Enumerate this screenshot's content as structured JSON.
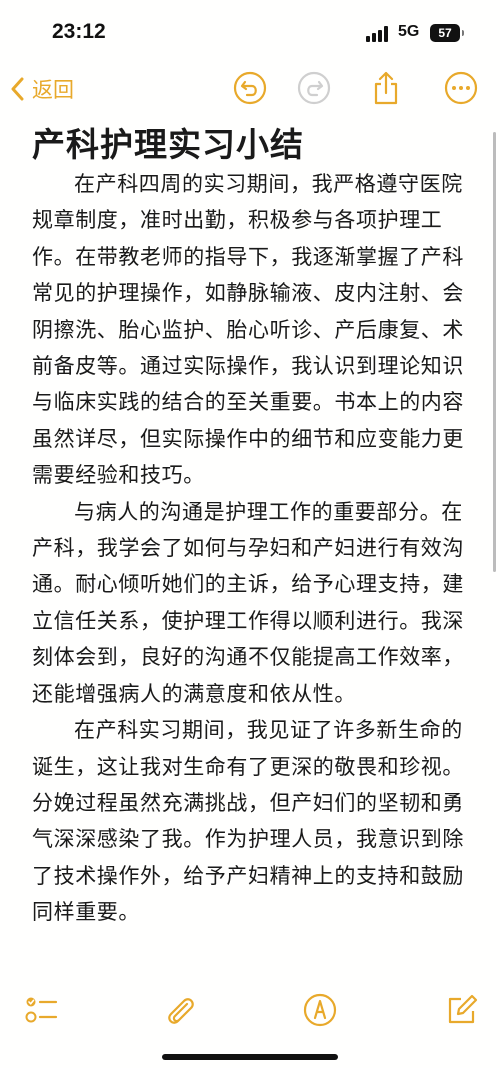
{
  "status_bar": {
    "time": "23:12",
    "network": "5G",
    "battery": "57"
  },
  "nav": {
    "back_label": "返回",
    "accent_color": "#e8a92b"
  },
  "note": {
    "title": "产科护理实习小结",
    "paragraphs": [
      "在产科四周的实习期间，我严格遵守医院规章制度，准时出勤，积极参与各项护理工作。在带教老师的指导下，我逐渐掌握了产科常见的护理操作，如静脉输液、皮内注射、会阴擦洗、胎心监护、胎心听诊、产后康复、术前备皮等。通过实际操作，我认识到理论知识与临床实践的结合的至关重要。书本上的内容虽然详尽，但实际操作中的细节和应变能力更需要经验和技巧。",
      "与病人的沟通是护理工作的重要部分。在产科，我学会了如何与孕妇和产妇进行有效沟通。耐心倾听她们的主诉，给予心理支持，建立信任关系，使护理工作得以顺利进行。我深刻体会到，良好的沟通不仅能提高工作效率，还能增强病人的满意度和依从性。",
      "在产科实习期间，我见证了许多新生命的诞生，这让我对生命有了更深的敬畏和珍视。分娩过程虽然充满挑战，但产妇们的坚韧和勇气深深感染了我。作为护理人员，我意识到除了技术操作外，给予产妇精神上的支持和鼓励同样重要。"
    ]
  },
  "icons": {
    "nav": [
      "undo-icon",
      "redo-icon",
      "share-icon",
      "more-icon"
    ],
    "toolbar": [
      "checklist-icon",
      "attachment-icon",
      "markup-icon",
      "compose-icon"
    ]
  }
}
